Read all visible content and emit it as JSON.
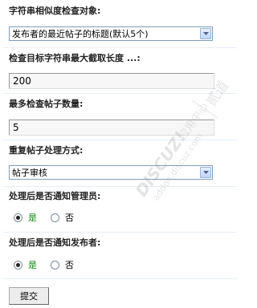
{
  "form": {
    "target_label": "字符串相似度检查对象:",
    "target_select_value": "发布者的最近帖子的标题(默认5个)",
    "max_length_label": "检查目标字符串最大截取长度 ...:",
    "max_length_value": "200",
    "max_posts_label": "最多检查帖子数量:",
    "max_posts_value": "5",
    "duplicate_action_label": "重复帖子处理方式:",
    "duplicate_action_value": "帖子审核",
    "notify_admin_label": "处理后是否通知管理员:",
    "notify_author_label": "处理后是否通知发布者:",
    "radio_yes": "是",
    "radio_no": "否",
    "submit_label": "提交"
  },
  "watermark": {
    "brand": "DISCUZ!",
    "chinese": "应用中心",
    "url": "addon.discuz.com",
    "side_text": "贰道"
  }
}
